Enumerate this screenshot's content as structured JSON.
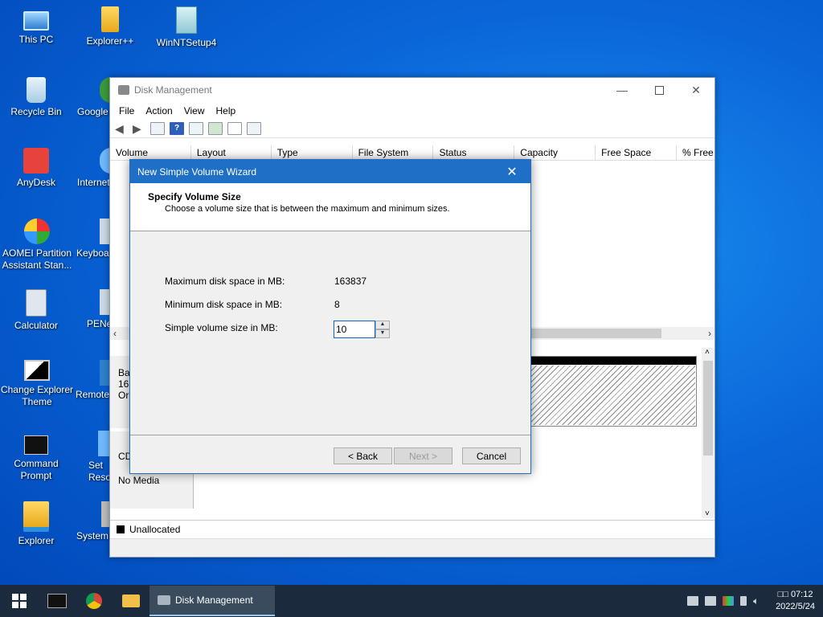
{
  "desktop": {
    "icons": [
      {
        "label": "This PC"
      },
      {
        "label": "Explorer++"
      },
      {
        "label": "WinNTSetup4"
      },
      {
        "label": "Recycle Bin"
      },
      {
        "label": "Google"
      },
      {
        "label": "AnyDesk"
      },
      {
        "label": "Internet"
      },
      {
        "label": "AOMEI Partition Assistant Stan..."
      },
      {
        "label": "Keyboa"
      },
      {
        "label": "Calculator"
      },
      {
        "label": "PENe"
      },
      {
        "label": "Change Explorer Theme"
      },
      {
        "label": "Remote"
      },
      {
        "label": "Command Prompt"
      },
      {
        "label": "Set Reso"
      },
      {
        "label": "Explorer"
      },
      {
        "label": "System"
      }
    ]
  },
  "disk_management": {
    "title": "Disk Management",
    "menu": [
      "File",
      "Action",
      "View",
      "Help"
    ],
    "columns": [
      "Volume",
      "Layout",
      "Type",
      "File System",
      "Status",
      "Capacity",
      "Free Space",
      "% Free"
    ],
    "disk0": {
      "line1": "Ba",
      "line2": "16(",
      "line3": "Or"
    },
    "cd": {
      "label": "CD",
      "media": "No Media"
    },
    "legend": {
      "unallocated": "Unallocated"
    }
  },
  "wizard": {
    "title": "New Simple Volume Wizard",
    "heading": "Specify Volume Size",
    "subheading": "Choose a volume size that is between the maximum and minimum sizes.",
    "max_label": "Maximum disk space in MB:",
    "max_value": "163837",
    "min_label": "Minimum disk space in MB:",
    "min_value": "8",
    "size_label": "Simple volume size in MB:",
    "size_value": "10",
    "back_label": "< Back",
    "next_label": "Next >",
    "cancel_label": "Cancel",
    "colors": {
      "titlebar": "#1f6fc7"
    }
  },
  "taskbar": {
    "active_task": "Disk Management",
    "clock_time": "07:12",
    "clock_prefix": "□□",
    "clock_date": "2022/5/24"
  }
}
